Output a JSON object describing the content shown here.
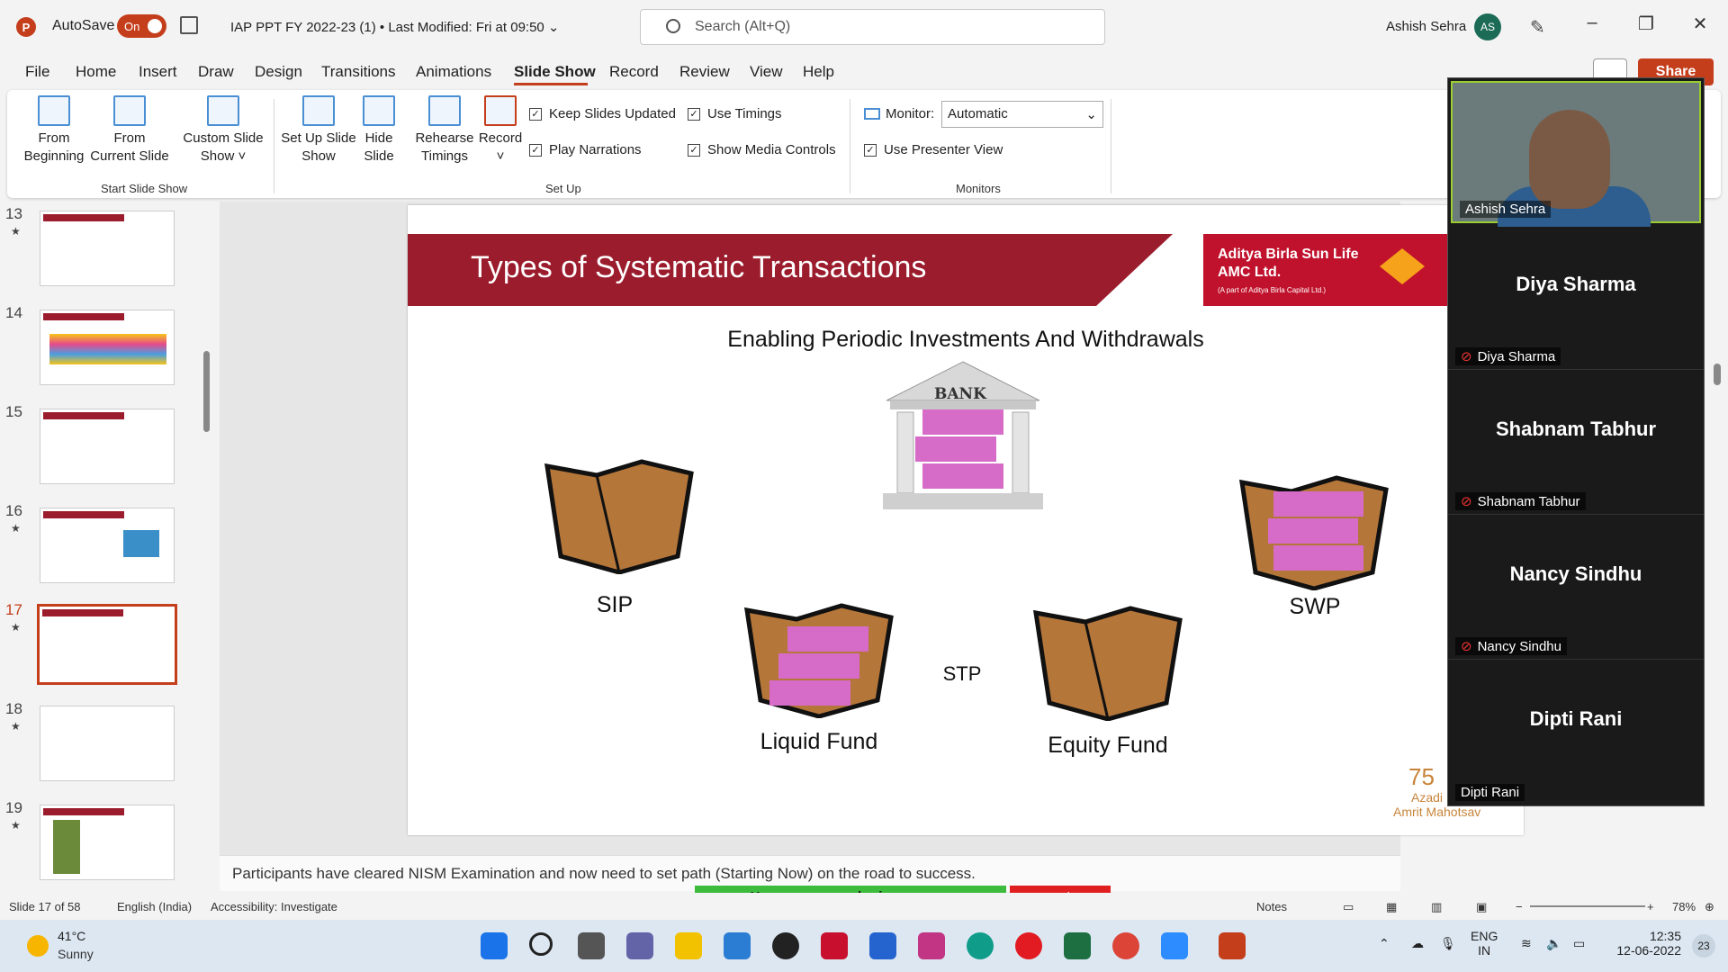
{
  "titlebar": {
    "autosave_label": "AutoSave",
    "autosave_state": "On",
    "doc_title": "IAP PPT FY 2022-23 (1) • Last Modified: Fri at 09:50 ⌄",
    "search_placeholder": "Search (Alt+Q)",
    "user_name": "Ashish Sehra",
    "user_initials": "AS",
    "app_logo": "P"
  },
  "tabs": [
    "File",
    "Home",
    "Insert",
    "Draw",
    "Design",
    "Transitions",
    "Animations",
    "Slide Show",
    "Record",
    "Review",
    "View",
    "Help"
  ],
  "active_tab": "Slide Show",
  "share_label": "Share",
  "ribbon": {
    "from_beginning": "From Beginning",
    "from_current": "From Current Slide",
    "custom_show": "Custom Slide Show ˅",
    "group_start": "Start Slide Show",
    "setup_show": "Set Up Slide Show",
    "hide_slide": "Hide Slide",
    "rehearse": "Rehearse Timings",
    "record": "Record ˅",
    "keep_updated": "Keep Slides Updated",
    "play_narrations": "Play Narrations",
    "use_timings": "Use Timings",
    "show_media": "Show Media Controls",
    "group_setup": "Set Up",
    "monitor_label": "Monitor:",
    "monitor_value": "Automatic",
    "presenter_view": "Use Presenter View",
    "group_monitors": "Monitors"
  },
  "thumbnails": [
    {
      "num": "13",
      "star": "★"
    },
    {
      "num": "14",
      "star": ""
    },
    {
      "num": "15",
      "star": ""
    },
    {
      "num": "16",
      "star": "★"
    },
    {
      "num": "17",
      "star": "★"
    },
    {
      "num": "18",
      "star": "★"
    },
    {
      "num": "19",
      "star": "★"
    }
  ],
  "slide": {
    "title": "Types of Systematic Transactions",
    "subtitle": "Enabling Periodic Investments And Withdrawals",
    "logo_line1": "Aditya Birla Sun Life",
    "logo_line2": "AMC Ltd.",
    "logo_line3": "(A part of Aditya Birla Capital Ltd.)",
    "bank_label": "BANK",
    "sip": "SIP",
    "swp": "SWP",
    "stp": "STP",
    "liquid_fund": "Liquid Fund",
    "equity_fund": "Equity Fund",
    "badge_75": "75",
    "azadi": "Azadi",
    "amrit": "Amrit Mahotsav"
  },
  "notes": "Participants have cleared NISM Examination and now need to set path (Starting Now) on the road to success.",
  "participants": {
    "presenter": "Ashish Sehra",
    "others": [
      "Diya Sharma",
      "Shabnam Tabhur",
      "Nancy Sindhu",
      "Dipti Rani"
    ]
  },
  "sharing": {
    "banner": "You are screen sharing",
    "stop": "Stop Share"
  },
  "status": {
    "slide_of": "Slide 17 of 58",
    "language": "English (India)",
    "accessibility": "Accessibility: Investigate",
    "notes": "Notes",
    "zoom": "78%"
  },
  "taskbar": {
    "temp": "41°C",
    "weather": "Sunny",
    "lang1": "ENG",
    "lang2": "IN",
    "time": "12:35",
    "date": "12-06-2022",
    "notif": "23"
  }
}
